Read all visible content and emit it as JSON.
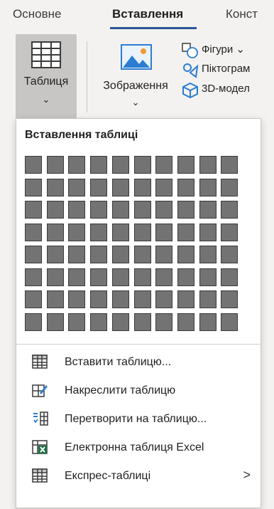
{
  "ribbon_tabs": {
    "home": "Основне",
    "insert": "Вставлення",
    "design": "Конст"
  },
  "ribbon": {
    "table_label": "Таблиця",
    "pictures_label": "Зображення",
    "dropdown_chevron": "⌄",
    "shapes_label": "Фігури ⌄",
    "icons_label": "Піктограм",
    "models_label": "3D-модел"
  },
  "insert_table_menu": {
    "title": "Вставлення таблиці",
    "grid": {
      "columns": 10,
      "rows": 8
    },
    "items": [
      {
        "label": "Вставити таблицю...",
        "icon": "table-icon"
      },
      {
        "label": "Накреслити таблицю",
        "icon": "draw-table-icon"
      },
      {
        "label": "Перетворити на таблицю...",
        "icon": "convert-text-to-table-icon"
      },
      {
        "label": "Електронна таблиця Excel",
        "icon": "excel-spreadsheet-icon"
      },
      {
        "label": "Експрес-таблиці",
        "icon": "quick-tables-icon",
        "submenu_arrow": ">"
      }
    ]
  },
  "colors": {
    "accent": "#2b579a",
    "grid_cell": "#737373",
    "excel_green": "#1e7145",
    "selected_button": "#c8c6c4"
  }
}
